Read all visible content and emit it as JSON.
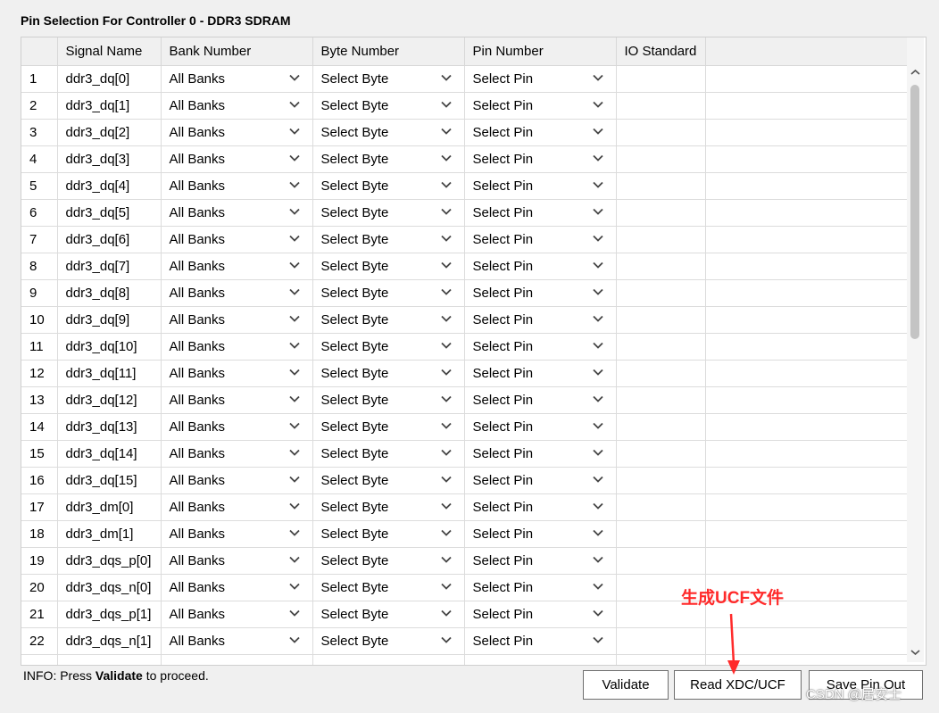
{
  "title": "Pin Selection For Controller 0 - DDR3 SDRAM",
  "columns": [
    "",
    "Signal Name",
    "Bank Number",
    "Byte Number",
    "Pin Number",
    "IO Standard"
  ],
  "rows": [
    {
      "num": "1",
      "signal": "ddr3_dq[0]",
      "bank": "All Banks",
      "byte": "Select Byte",
      "pin": "Select Pin",
      "io": ""
    },
    {
      "num": "2",
      "signal": "ddr3_dq[1]",
      "bank": "All Banks",
      "byte": "Select Byte",
      "pin": "Select Pin",
      "io": ""
    },
    {
      "num": "3",
      "signal": "ddr3_dq[2]",
      "bank": "All Banks",
      "byte": "Select Byte",
      "pin": "Select Pin",
      "io": ""
    },
    {
      "num": "4",
      "signal": "ddr3_dq[3]",
      "bank": "All Banks",
      "byte": "Select Byte",
      "pin": "Select Pin",
      "io": ""
    },
    {
      "num": "5",
      "signal": "ddr3_dq[4]",
      "bank": "All Banks",
      "byte": "Select Byte",
      "pin": "Select Pin",
      "io": ""
    },
    {
      "num": "6",
      "signal": "ddr3_dq[5]",
      "bank": "All Banks",
      "byte": "Select Byte",
      "pin": "Select Pin",
      "io": ""
    },
    {
      "num": "7",
      "signal": "ddr3_dq[6]",
      "bank": "All Banks",
      "byte": "Select Byte",
      "pin": "Select Pin",
      "io": ""
    },
    {
      "num": "8",
      "signal": "ddr3_dq[7]",
      "bank": "All Banks",
      "byte": "Select Byte",
      "pin": "Select Pin",
      "io": ""
    },
    {
      "num": "9",
      "signal": "ddr3_dq[8]",
      "bank": "All Banks",
      "byte": "Select Byte",
      "pin": "Select Pin",
      "io": ""
    },
    {
      "num": "10",
      "signal": "ddr3_dq[9]",
      "bank": "All Banks",
      "byte": "Select Byte",
      "pin": "Select Pin",
      "io": ""
    },
    {
      "num": "11",
      "signal": "ddr3_dq[10]",
      "bank": "All Banks",
      "byte": "Select Byte",
      "pin": "Select Pin",
      "io": ""
    },
    {
      "num": "12",
      "signal": "ddr3_dq[11]",
      "bank": "All Banks",
      "byte": "Select Byte",
      "pin": "Select Pin",
      "io": ""
    },
    {
      "num": "13",
      "signal": "ddr3_dq[12]",
      "bank": "All Banks",
      "byte": "Select Byte",
      "pin": "Select Pin",
      "io": ""
    },
    {
      "num": "14",
      "signal": "ddr3_dq[13]",
      "bank": "All Banks",
      "byte": "Select Byte",
      "pin": "Select Pin",
      "io": ""
    },
    {
      "num": "15",
      "signal": "ddr3_dq[14]",
      "bank": "All Banks",
      "byte": "Select Byte",
      "pin": "Select Pin",
      "io": ""
    },
    {
      "num": "16",
      "signal": "ddr3_dq[15]",
      "bank": "All Banks",
      "byte": "Select Byte",
      "pin": "Select Pin",
      "io": ""
    },
    {
      "num": "17",
      "signal": "ddr3_dm[0]",
      "bank": "All Banks",
      "byte": "Select Byte",
      "pin": "Select Pin",
      "io": ""
    },
    {
      "num": "18",
      "signal": "ddr3_dm[1]",
      "bank": "All Banks",
      "byte": "Select Byte",
      "pin": "Select Pin",
      "io": ""
    },
    {
      "num": "19",
      "signal": "ddr3_dqs_p[0]",
      "bank": "All Banks",
      "byte": "Select Byte",
      "pin": "Select Pin",
      "io": ""
    },
    {
      "num": "20",
      "signal": "ddr3_dqs_n[0]",
      "bank": "All Banks",
      "byte": "Select Byte",
      "pin": "Select Pin",
      "io": ""
    },
    {
      "num": "21",
      "signal": "ddr3_dqs_p[1]",
      "bank": "All Banks",
      "byte": "Select Byte",
      "pin": "Select Pin",
      "io": ""
    },
    {
      "num": "22",
      "signal": "ddr3_dqs_n[1]",
      "bank": "All Banks",
      "byte": "Select Byte",
      "pin": "Select Pin",
      "io": ""
    }
  ],
  "info": {
    "prefix": "INFO: Press ",
    "bold": "Validate",
    "suffix": " to proceed."
  },
  "buttons": {
    "validate": "Validate",
    "read": "Read XDC/UCF",
    "save": "Save Pin Out"
  },
  "annotation": {
    "text": "生成UCF文件",
    "color": "#ff2a2a"
  },
  "watermark": "CSDN @居安士"
}
